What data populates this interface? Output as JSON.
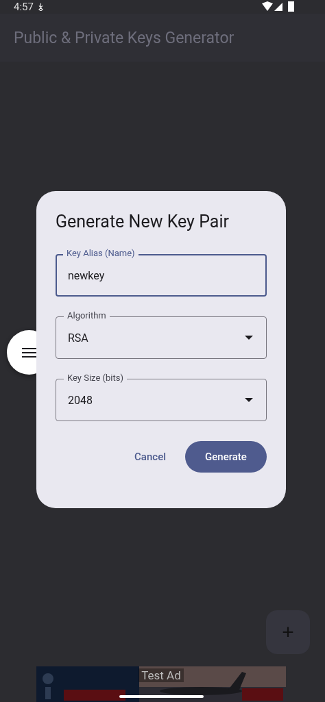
{
  "status_bar": {
    "time": "4:57"
  },
  "app_bar": {
    "title": "Public & Private Keys Generator"
  },
  "dialog": {
    "title": "Generate New Key Pair",
    "fields": [
      {
        "kind": "text",
        "label": "Key Alias (Name)",
        "value": "newkey",
        "focused": true
      },
      {
        "kind": "dropdown",
        "label": "Algorithm",
        "value": "RSA",
        "focused": false
      },
      {
        "kind": "dropdown",
        "label": "Key Size (bits)",
        "value": "2048",
        "focused": false
      }
    ],
    "buttons": [
      {
        "kind": "text",
        "label": "Cancel"
      },
      {
        "kind": "filled",
        "label": "Generate"
      }
    ]
  },
  "fab": {
    "symbol": "+"
  },
  "ad": {
    "kind": "picture",
    "label": "Test Ad"
  }
}
